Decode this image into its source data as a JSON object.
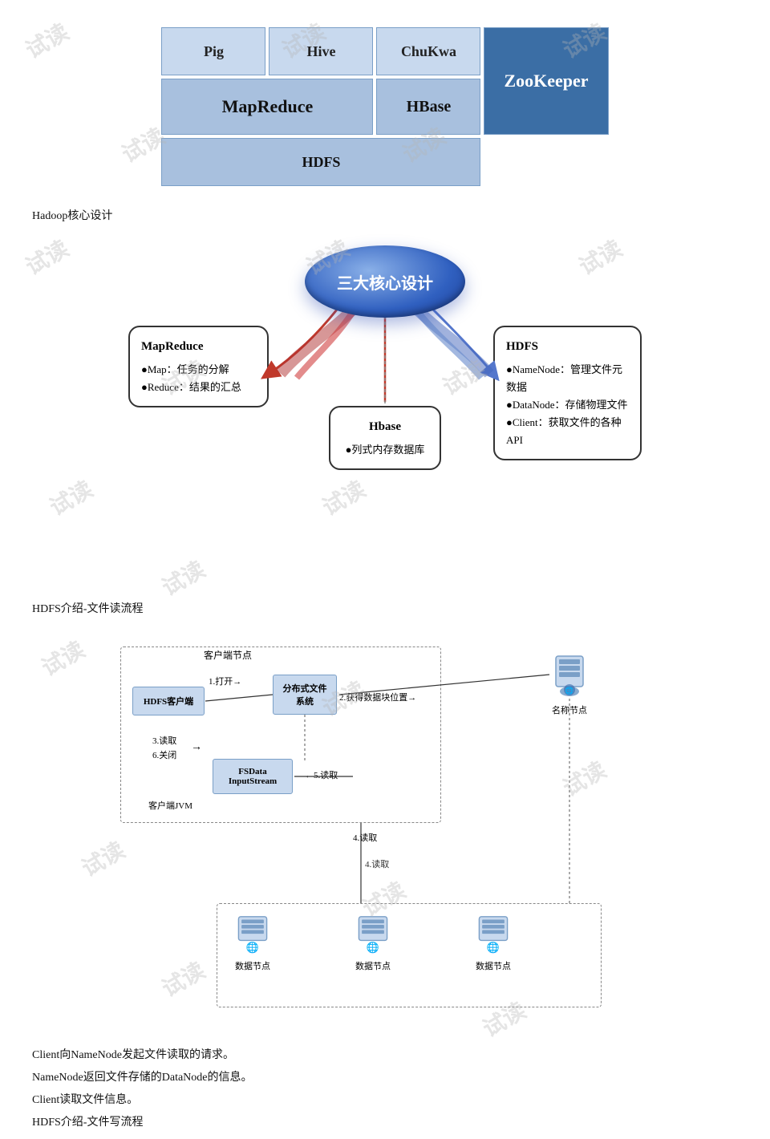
{
  "watermark_text": "试读",
  "section1": {
    "cells": {
      "pig": "Pig",
      "hive": "Hive",
      "chukwa": "ChuKwa",
      "mapreduce": "MapReduce",
      "hbase": "HBase",
      "zookeeper": "ZooKeeper",
      "hdfs": "HDFS"
    },
    "label": "Hadoop核心设计"
  },
  "section2": {
    "disc_text": "三大核心设计",
    "mapreduce": {
      "title": "MapReduce",
      "points": [
        "●Map：任务的分解",
        "●Reduce：结果的汇总"
      ]
    },
    "hbase": {
      "title": "Hbase",
      "points": [
        "●列式内存数据库"
      ]
    },
    "hdfs": {
      "title": "HDFS",
      "points": [
        "●NameNode：管理文件元数据",
        "●DataNode：存储物理文件",
        "●Client：获取文件的各种API"
      ]
    }
  },
  "section3": {
    "label": "HDFS介绍-文件读流程",
    "client_area": "客户端节点",
    "hdfs_client": "HDFS客户端",
    "dist_fs": "分布式文件\n系统",
    "step1": "1.打开→",
    "step2": "2.获得数据块位置→",
    "step3_6": "3.读取\n6.关闭",
    "step3_6_arrow": "→",
    "fsdata": "FSData\nInputStream",
    "client_jvm": "客户端JVM",
    "step4": "4.读取",
    "step5": "←5.读取",
    "namenode": "名称节点",
    "datanode1": "数据节点",
    "datanode2": "数据节点",
    "datanode3": "数据节点"
  },
  "bottom": {
    "line1": "Client向NameNode发起文件读取的请求。",
    "line2": "NameNode返回文件存储的DataNode的信息。",
    "line3": "Client读取文件信息。",
    "line4": "HDFS介绍-文件写流程"
  }
}
